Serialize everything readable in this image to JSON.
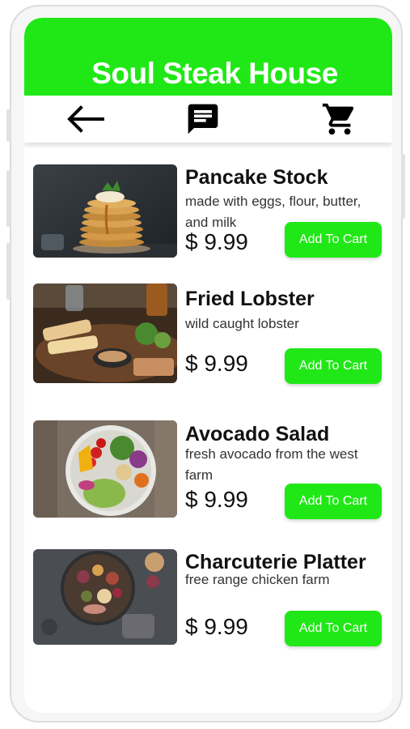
{
  "app": {
    "title": "Soul Steak House",
    "accent_color": "#20e816"
  },
  "nav": {
    "back_icon": "arrow-left-icon",
    "chat_icon": "chat-icon",
    "cart_icon": "shopping-cart-icon"
  },
  "menu": {
    "items": [
      {
        "name": "Pancake Stock",
        "description": "made with eggs, flour, butter, and milk",
        "price": "$ 9.99",
        "button_label": "Add To Cart",
        "image": "pancake-stack-photo"
      },
      {
        "name": "Fried Lobster",
        "description": "wild caught lobster",
        "price": "$ 9.99",
        "button_label": "Add To Cart",
        "image": "fried-lobster-photo"
      },
      {
        "name": "Avocado Salad",
        "description": "fresh avocado from the west farm",
        "price": "$ 9.99",
        "button_label": "Add To Cart",
        "image": "avocado-salad-photo"
      },
      {
        "name": "Charcuterie Platter",
        "description": "free range chicken farm",
        "price": "$ 9.99",
        "button_label": "Add To Cart",
        "image": "charcuterie-platter-photo"
      }
    ]
  }
}
